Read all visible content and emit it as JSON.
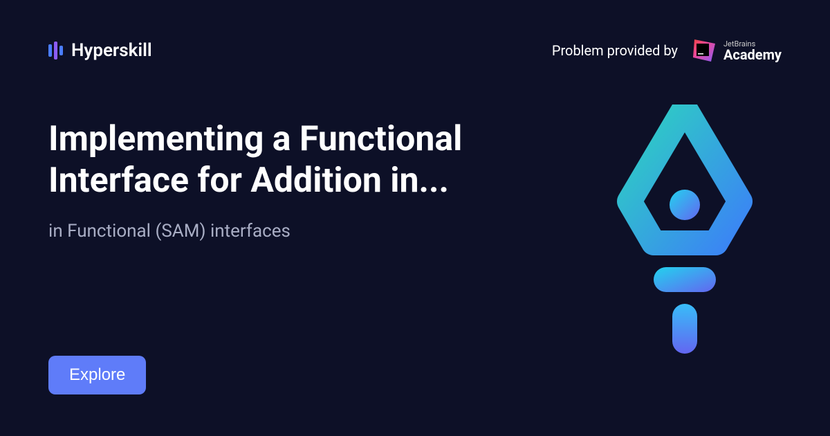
{
  "header": {
    "brand_name": "Hyperskill",
    "provider_label": "Problem provided by",
    "jb_small": "JetBrains",
    "jb_big": "Academy"
  },
  "main": {
    "title": "Implementing a Functional Interface for Addition in...",
    "subtitle": "in Functional (SAM) interfaces"
  },
  "cta": {
    "explore_label": "Explore"
  }
}
